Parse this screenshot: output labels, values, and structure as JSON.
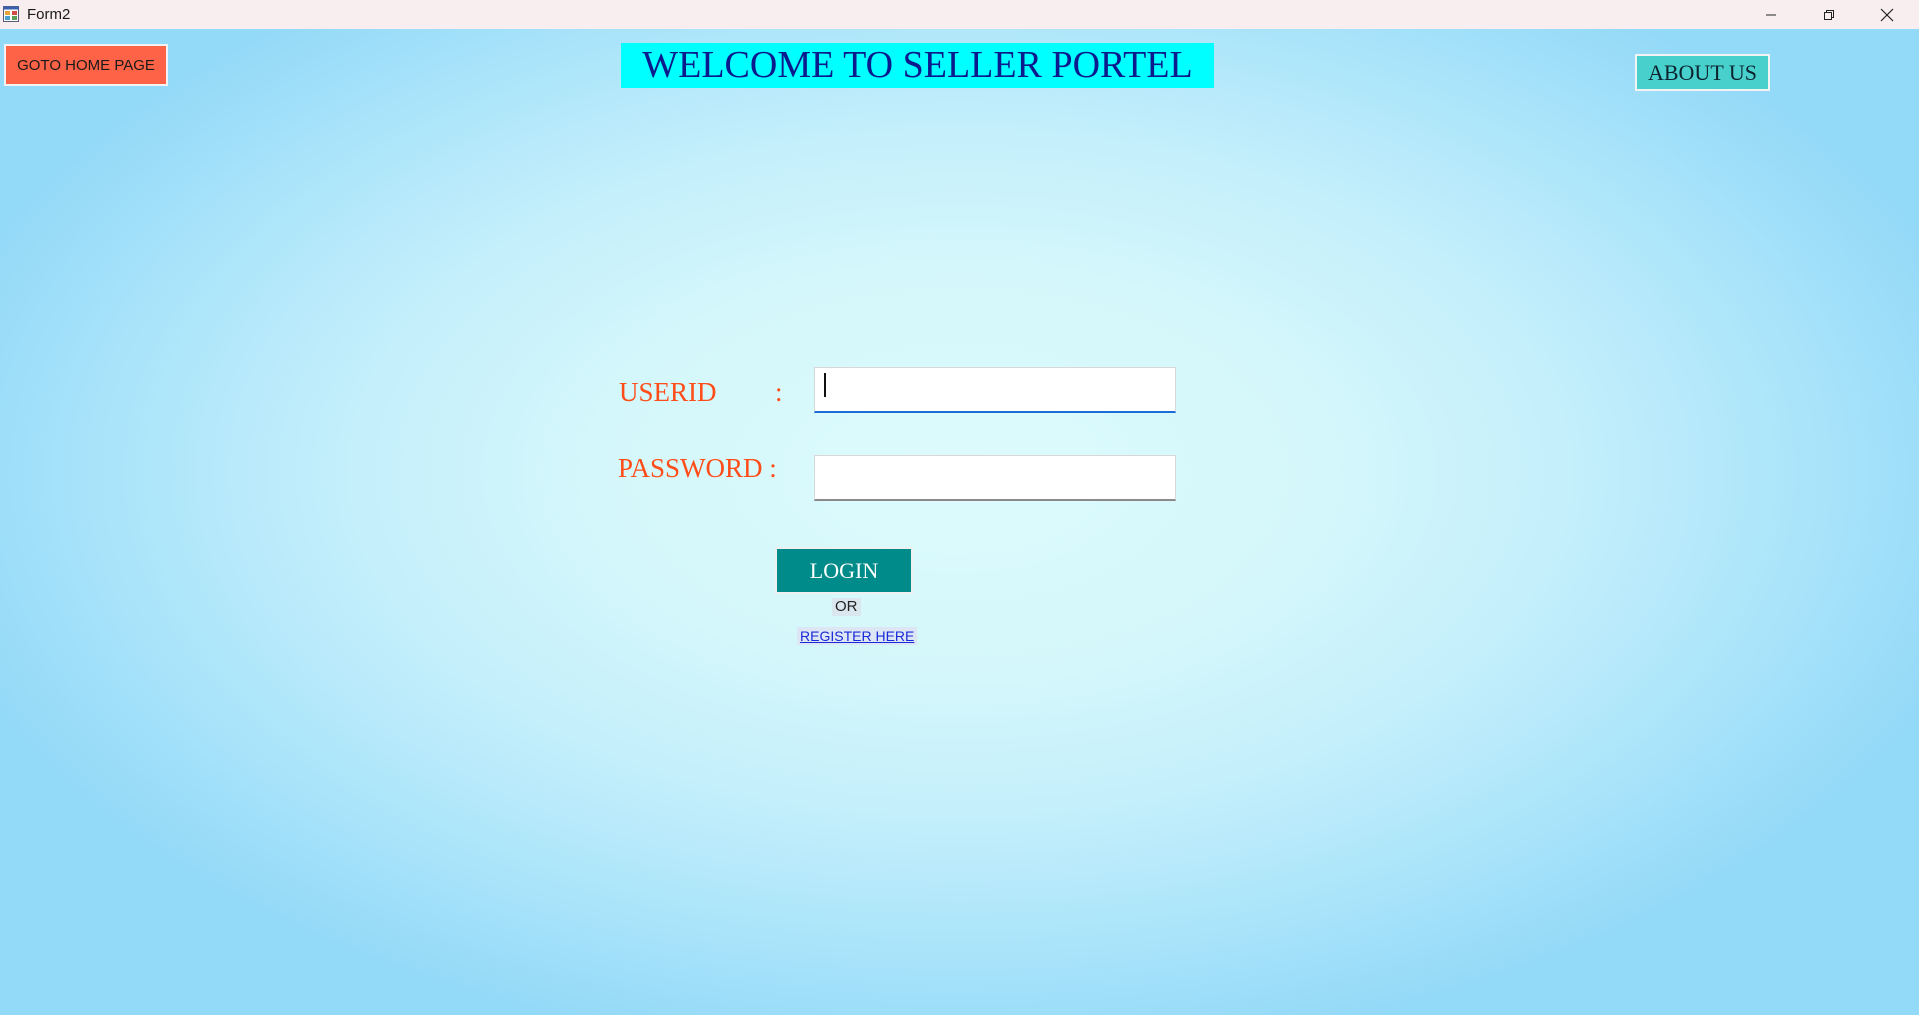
{
  "window": {
    "title": "Form2",
    "controls": {
      "minimize": "minimize-icon",
      "restore": "restore-icon",
      "close": "close-icon"
    }
  },
  "header": {
    "home_button_label": "GOTO HOME PAGE",
    "page_title": "WELCOME TO SELLER PORTEL",
    "about_button_label": "ABOUT US"
  },
  "login_form": {
    "userid_label": "USERID",
    "userid_colon": ":",
    "userid_value": "",
    "password_label": "PASSWORD :",
    "password_value": "",
    "login_button_label": "LOGIN",
    "or_text": "OR",
    "register_link_text": "REGISTER HERE"
  },
  "colors": {
    "home_button_bg": "#ff6347",
    "title_bg": "#00ffff",
    "title_text": "#0b1a8c",
    "about_button_bg": "#48d1cc",
    "label_text": "#ff4d1a",
    "login_button_bg": "#008b8b",
    "link_text": "#1a2ad9"
  }
}
